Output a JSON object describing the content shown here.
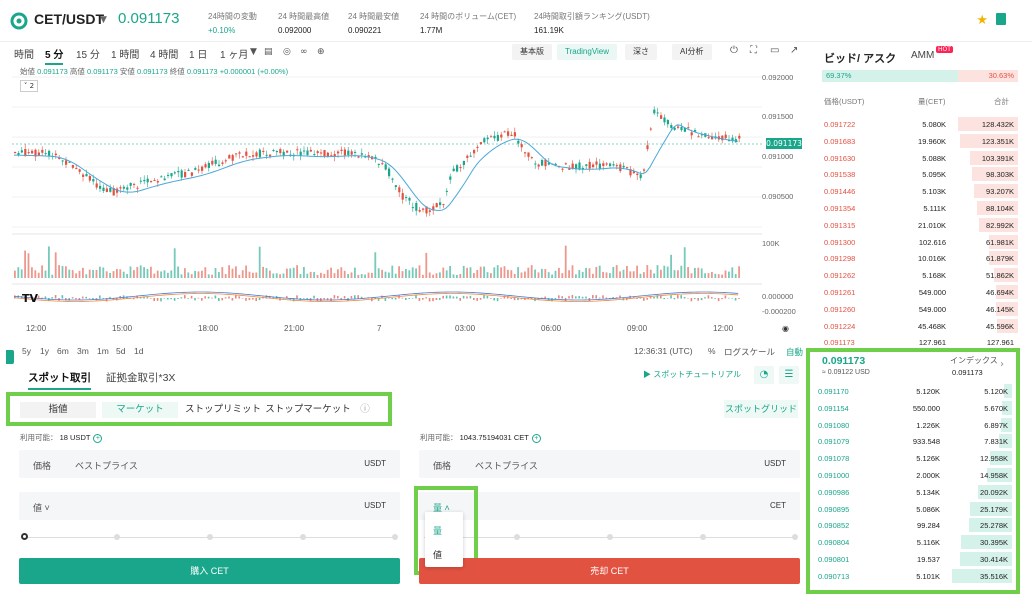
{
  "header": {
    "pair": "CET/USDT",
    "last_price": "0.091173",
    "stats": [
      {
        "label": "24時間の変動",
        "value": "+0.10%"
      },
      {
        "label": "24 時間最高値",
        "value": "0.092000"
      },
      {
        "label": "24 時間最安値",
        "value": "0.090221"
      },
      {
        "label": "24 時間のボリューム(CET)",
        "value": "1.77M"
      },
      {
        "label": "24時間取引額ランキング(USDT)",
        "value": "161.19K"
      }
    ]
  },
  "chart": {
    "timeframes": [
      "時間",
      "5 分",
      "15 分",
      "1 時間",
      "4 時間",
      "1 日",
      "1 ヶ月"
    ],
    "active_timeframe": "5 分",
    "views": [
      "基本版",
      "TradingView",
      "深さ",
      "AI分析"
    ],
    "active_view": "TradingView",
    "ohlc": {
      "open_label": "始値",
      "open": "0.091173",
      "high_label": "高値",
      "high": "0.091173",
      "low_label": "安値",
      "low": "0.091173",
      "close_label": "終値",
      "close": "0.091173",
      "change": "+0.000001 (+0.00%)"
    },
    "indicator_chip": "2",
    "price_ticks": [
      "0.092000",
      "0.091500",
      "0.091000",
      "0.090500"
    ],
    "last_tag": "0.091173",
    "volume_tick": "100K",
    "macd_ticks": [
      "0.000000",
      "-0.000200"
    ],
    "time_labels": [
      "12:00",
      "15:00",
      "18:00",
      "21:00",
      "7",
      "03:00",
      "06:00",
      "09:00",
      "12:00"
    ],
    "ranges": [
      "5y",
      "1y",
      "6m",
      "3m",
      "1m",
      "5d",
      "1d"
    ],
    "clock": "12:36:31 (UTC)",
    "percent": "%",
    "log_scale": "ログスケール",
    "auto": "自動"
  },
  "order": {
    "modes": [
      "スポット取引",
      "証拠金取引*3X"
    ],
    "active_mode": "スポット取引",
    "tutorial": "スポットチュートリアル",
    "types": [
      "指値",
      "マーケット",
      "ストップリミット",
      "ストップマーケット"
    ],
    "active_type": "マーケット",
    "grid": "スポットグリッド",
    "buy_avail_label": "利用可能：",
    "buy_avail": "18 USDT",
    "sell_avail_label": "利用可能：",
    "sell_avail": "1043.75194031 CET",
    "price_label": "価格",
    "price_value": "ベストプライス",
    "usdt": "USDT",
    "cet": "CET",
    "amount_select": "値",
    "qty_select": "量",
    "dropdown": [
      "量",
      "値"
    ],
    "buy_btn": "購入 CET",
    "sell_btn": "売却 CET"
  },
  "orderbook": {
    "title": "ビッド/ アスク",
    "amm": "AMM",
    "hot": "HOT",
    "bid_ratio": "69.37%",
    "ask_ratio": "30.63%",
    "bid_fraction": 0.6937,
    "cols": [
      "価格(USDT)",
      "量(CET)",
      "合計"
    ],
    "asks": [
      {
        "p": "0.091722",
        "a": "5.080K",
        "t": "128.432K",
        "d": 1.0
      },
      {
        "p": "0.091683",
        "a": "19.960K",
        "t": "123.351K",
        "d": 0.96
      },
      {
        "p": "0.091630",
        "a": "5.088K",
        "t": "103.391K",
        "d": 0.8
      },
      {
        "p": "0.091538",
        "a": "5.095K",
        "t": "98.303K",
        "d": 0.77
      },
      {
        "p": "0.091446",
        "a": "5.103K",
        "t": "93.207K",
        "d": 0.73
      },
      {
        "p": "0.091354",
        "a": "5.111K",
        "t": "88.104K",
        "d": 0.69
      },
      {
        "p": "0.091315",
        "a": "21.010K",
        "t": "82.992K",
        "d": 0.65
      },
      {
        "p": "0.091300",
        "a": "102.616",
        "t": "61.981K",
        "d": 0.48
      },
      {
        "p": "0.091298",
        "a": "10.016K",
        "t": "61.879K",
        "d": 0.48
      },
      {
        "p": "0.091262",
        "a": "5.168K",
        "t": "51.862K",
        "d": 0.4
      },
      {
        "p": "0.091261",
        "a": "549.000",
        "t": "46.694K",
        "d": 0.36
      },
      {
        "p": "0.091260",
        "a": "549.000",
        "t": "46.145K",
        "d": 0.36
      },
      {
        "p": "0.091224",
        "a": "45.468K",
        "t": "45.596K",
        "d": 0.35
      },
      {
        "p": "0.091173",
        "a": "127.961",
        "t": "127.961",
        "d": 0.0
      }
    ],
    "mid_price": "0.091173",
    "mid_sub": "≈ 0.09122  USD",
    "index_label": "インデックス",
    "index_value": "0.091173",
    "bids": [
      {
        "p": "0.091170",
        "a": "5.120K",
        "t": "5.120K",
        "d": 0.14
      },
      {
        "p": "0.091154",
        "a": "550.000",
        "t": "5.670K",
        "d": 0.16
      },
      {
        "p": "0.091080",
        "a": "1.226K",
        "t": "6.897K",
        "d": 0.19
      },
      {
        "p": "0.091079",
        "a": "933.548",
        "t": "7.831K",
        "d": 0.22
      },
      {
        "p": "0.091078",
        "a": "5.126K",
        "t": "12.958K",
        "d": 0.36
      },
      {
        "p": "0.091000",
        "a": "2.000K",
        "t": "14.958K",
        "d": 0.42
      },
      {
        "p": "0.090986",
        "a": "5.134K",
        "t": "20.092K",
        "d": 0.56
      },
      {
        "p": "0.090895",
        "a": "5.086K",
        "t": "25.179K",
        "d": 0.7
      },
      {
        "p": "0.090852",
        "a": "99.284",
        "t": "25.278K",
        "d": 0.71
      },
      {
        "p": "0.090804",
        "a": "5.116K",
        "t": "30.395K",
        "d": 0.85
      },
      {
        "p": "0.090801",
        "a": "19.537",
        "t": "30.414K",
        "d": 0.86
      },
      {
        "p": "0.090713",
        "a": "5.101K",
        "t": "35.516K",
        "d": 1.0
      }
    ]
  },
  "colors": {
    "accent": "#1aa68a",
    "sell": "#e15241",
    "highlight_box": "#6fcf4a"
  }
}
